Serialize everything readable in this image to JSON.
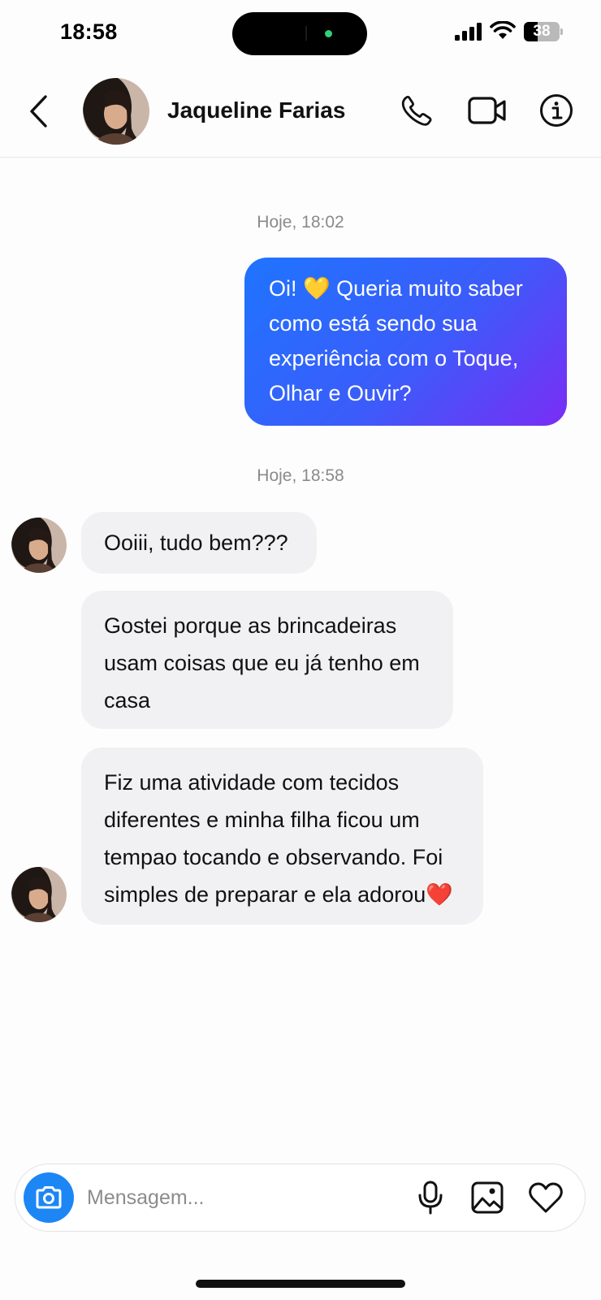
{
  "status_bar": {
    "time": "18:58",
    "battery_level": "38",
    "battery_fraction": 0.38
  },
  "header": {
    "contact_name": "Jaqueline Farias",
    "icons": [
      "back-icon",
      "phone-icon",
      "video-camera-icon",
      "info-icon"
    ]
  },
  "conversation": {
    "timestamps": [
      "Hoje, 18:02",
      "Hoje, 18:58"
    ],
    "outgoing": {
      "text_1": "Oi! ",
      "emoji": "💛",
      "text_2": " Queria muito saber como está sendo sua experiência com o Toque, Olhar e Ouvir?"
    },
    "incoming": [
      {
        "text": "Ooiii, tudo bem???"
      },
      {
        "text": "Gostei porque as brincadeiras usam coisas que eu já tenho em casa"
      },
      {
        "text": "Fiz uma atividade com tecidos diferentes e minha filha ficou um tempao tocando e observando. Foi simples de preparar e ela adorou",
        "emoji": "❤️"
      }
    ]
  },
  "composer": {
    "placeholder": "Mensagem...",
    "value": "",
    "icons": [
      "camera-icon",
      "microphone-icon",
      "gallery-icon",
      "heart-icon"
    ]
  },
  "colors": {
    "accent_blue": "#1d86f5",
    "outgoing_gradient_start": "#1f74ff",
    "outgoing_gradient_end": "#7a2df5",
    "incoming_bubble": "#f1f1f3"
  }
}
